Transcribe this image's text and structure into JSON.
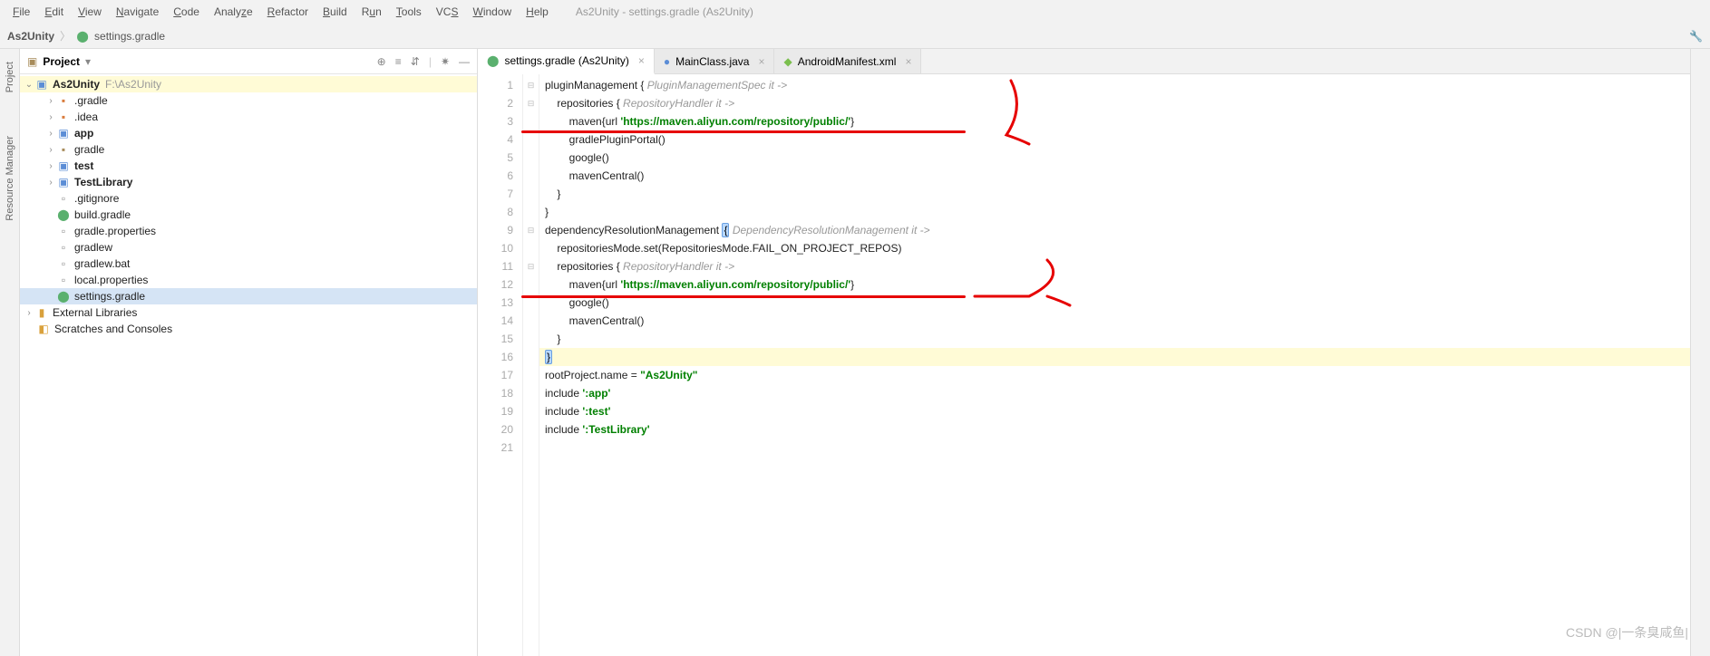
{
  "app_title": "As2Unity - settings.gradle (As2Unity)",
  "menu": [
    "File",
    "Edit",
    "View",
    "Navigate",
    "Code",
    "Analyze",
    "Refactor",
    "Build",
    "Run",
    "Tools",
    "VCS",
    "Window",
    "Help"
  ],
  "breadcrumb": {
    "root": "As2Unity",
    "file": "settings.gradle"
  },
  "left_tabs": [
    "Project",
    "Resource Manager"
  ],
  "sidebar_title": "Project",
  "tree": {
    "root": {
      "name": "As2Unity",
      "path": "F:\\As2Unity"
    },
    "items": [
      {
        "label": ".gradle",
        "icon": "folder-orange",
        "bold": false,
        "indent": 2,
        "arrow": ">"
      },
      {
        "label": ".idea",
        "icon": "folder-orange",
        "bold": false,
        "indent": 2,
        "arrow": ">"
      },
      {
        "label": "app",
        "icon": "module",
        "bold": true,
        "indent": 2,
        "arrow": ">"
      },
      {
        "label": "gradle",
        "icon": "folder",
        "bold": false,
        "indent": 2,
        "arrow": ">"
      },
      {
        "label": "test",
        "icon": "module",
        "bold": true,
        "indent": 2,
        "arrow": ">"
      },
      {
        "label": "TestLibrary",
        "icon": "module",
        "bold": true,
        "indent": 2,
        "arrow": ">"
      },
      {
        "label": ".gitignore",
        "icon": "file",
        "bold": false,
        "indent": 2,
        "arrow": ""
      },
      {
        "label": "build.gradle",
        "icon": "gradle",
        "bold": false,
        "indent": 2,
        "arrow": ""
      },
      {
        "label": "gradle.properties",
        "icon": "file",
        "bold": false,
        "indent": 2,
        "arrow": ""
      },
      {
        "label": "gradlew",
        "icon": "file",
        "bold": false,
        "indent": 2,
        "arrow": ""
      },
      {
        "label": "gradlew.bat",
        "icon": "file",
        "bold": false,
        "indent": 2,
        "arrow": ""
      },
      {
        "label": "local.properties",
        "icon": "file",
        "bold": false,
        "indent": 2,
        "arrow": ""
      },
      {
        "label": "settings.gradle",
        "icon": "gradle",
        "bold": false,
        "indent": 2,
        "arrow": "",
        "selected": true
      }
    ],
    "external": "External Libraries",
    "scratches": "Scratches and Consoles"
  },
  "editor": {
    "tabs": [
      {
        "label": "settings.gradle (As2Unity)",
        "icon": "gradle",
        "active": true
      },
      {
        "label": "MainClass.java",
        "icon": "java",
        "active": false
      },
      {
        "label": "AndroidManifest.xml",
        "icon": "android",
        "active": false
      }
    ],
    "lines": [
      {
        "n": 1,
        "code": "pluginManagement { ",
        "hint": "PluginManagementSpec it ->"
      },
      {
        "n": 2,
        "code": "    repositories { ",
        "hint": "RepositoryHandler it ->"
      },
      {
        "n": 3,
        "code": "        maven{url ",
        "str": "'https://maven.aliyun.com/repository/public/'",
        "after": "}"
      },
      {
        "n": 4,
        "code": "        gradlePluginPortal()"
      },
      {
        "n": 5,
        "code": "        google()"
      },
      {
        "n": 6,
        "code": "        mavenCentral()"
      },
      {
        "n": 7,
        "code": "    }"
      },
      {
        "n": 8,
        "code": "}"
      },
      {
        "n": 9,
        "code": "dependencyResolutionManagement ",
        "brace": "{",
        "hint": " DependencyResolutionManagement it ->"
      },
      {
        "n": 10,
        "code": "    repositoriesMode.set(RepositoriesMode.FAIL_ON_PROJECT_REPOS)"
      },
      {
        "n": 11,
        "code": "    repositories { ",
        "hint": "RepositoryHandler it ->"
      },
      {
        "n": 12,
        "code": "        maven{url ",
        "str": "'https://maven.aliyun.com/repository/public/'",
        "after": "}"
      },
      {
        "n": 13,
        "code": "        google()"
      },
      {
        "n": 14,
        "code": "        mavenCentral()"
      },
      {
        "n": 15,
        "code": "    }"
      },
      {
        "n": 16,
        "code": "",
        "brace": "}",
        "hl": true
      },
      {
        "n": 17,
        "code": "rootProject.name = ",
        "str": "\"As2Unity\""
      },
      {
        "n": 18,
        "code": "include ",
        "str": "':app'"
      },
      {
        "n": 19,
        "code": "include ",
        "str": "':test'"
      },
      {
        "n": 20,
        "code": "include ",
        "str": "':TestLibrary'"
      },
      {
        "n": 21,
        "code": ""
      }
    ]
  },
  "watermark": "CSDN @|一条臭咸鱼|"
}
